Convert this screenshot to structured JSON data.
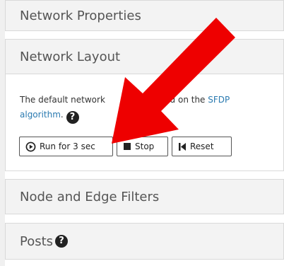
{
  "sections": {
    "network_properties": {
      "title": "Network Properties"
    },
    "network_layout": {
      "title": "Network Layout",
      "description_part1": "The default network",
      "description_part2": "sed on the ",
      "link_text_1": "SFDP",
      "link_text_2": "algorithm",
      "period": ".",
      "help_glyph": "?",
      "buttons": {
        "run_label": "Run for 3 sec",
        "stop_label": "Stop",
        "reset_label": "Reset"
      }
    },
    "node_edge_filters": {
      "title": "Node and Edge Filters"
    },
    "posts": {
      "title": "Posts",
      "help_glyph": "?"
    }
  },
  "annotation": {
    "color": "#ee0000",
    "shape": "arrow"
  },
  "icons": [
    "play-circle-icon",
    "stop-icon",
    "skip-back-icon",
    "help-icon"
  ]
}
